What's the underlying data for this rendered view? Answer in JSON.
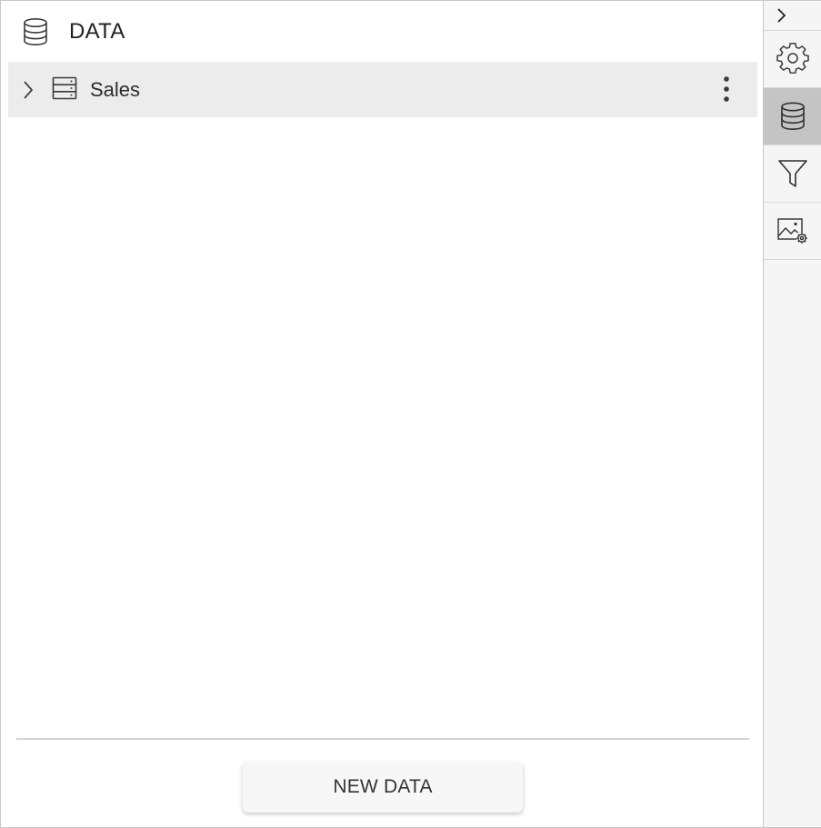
{
  "panel": {
    "title": "DATA",
    "header_icon": "database-icon"
  },
  "data_sources": [
    {
      "label": "Sales",
      "expand_icon": "chevron-right-icon",
      "type_icon": "table-icon",
      "menu_icon": "more-vertical-icon"
    }
  ],
  "footer": {
    "new_data_label": "NEW DATA"
  },
  "sidebar": {
    "collapse_icon": "chevron-right-icon",
    "items": [
      {
        "icon": "gear-icon",
        "name": "properties",
        "active": false
      },
      {
        "icon": "database-icon",
        "name": "data",
        "active": true
      },
      {
        "icon": "filter-icon",
        "name": "filter",
        "active": false
      },
      {
        "icon": "image-settings-icon",
        "name": "image-settings",
        "active": false
      }
    ]
  }
}
